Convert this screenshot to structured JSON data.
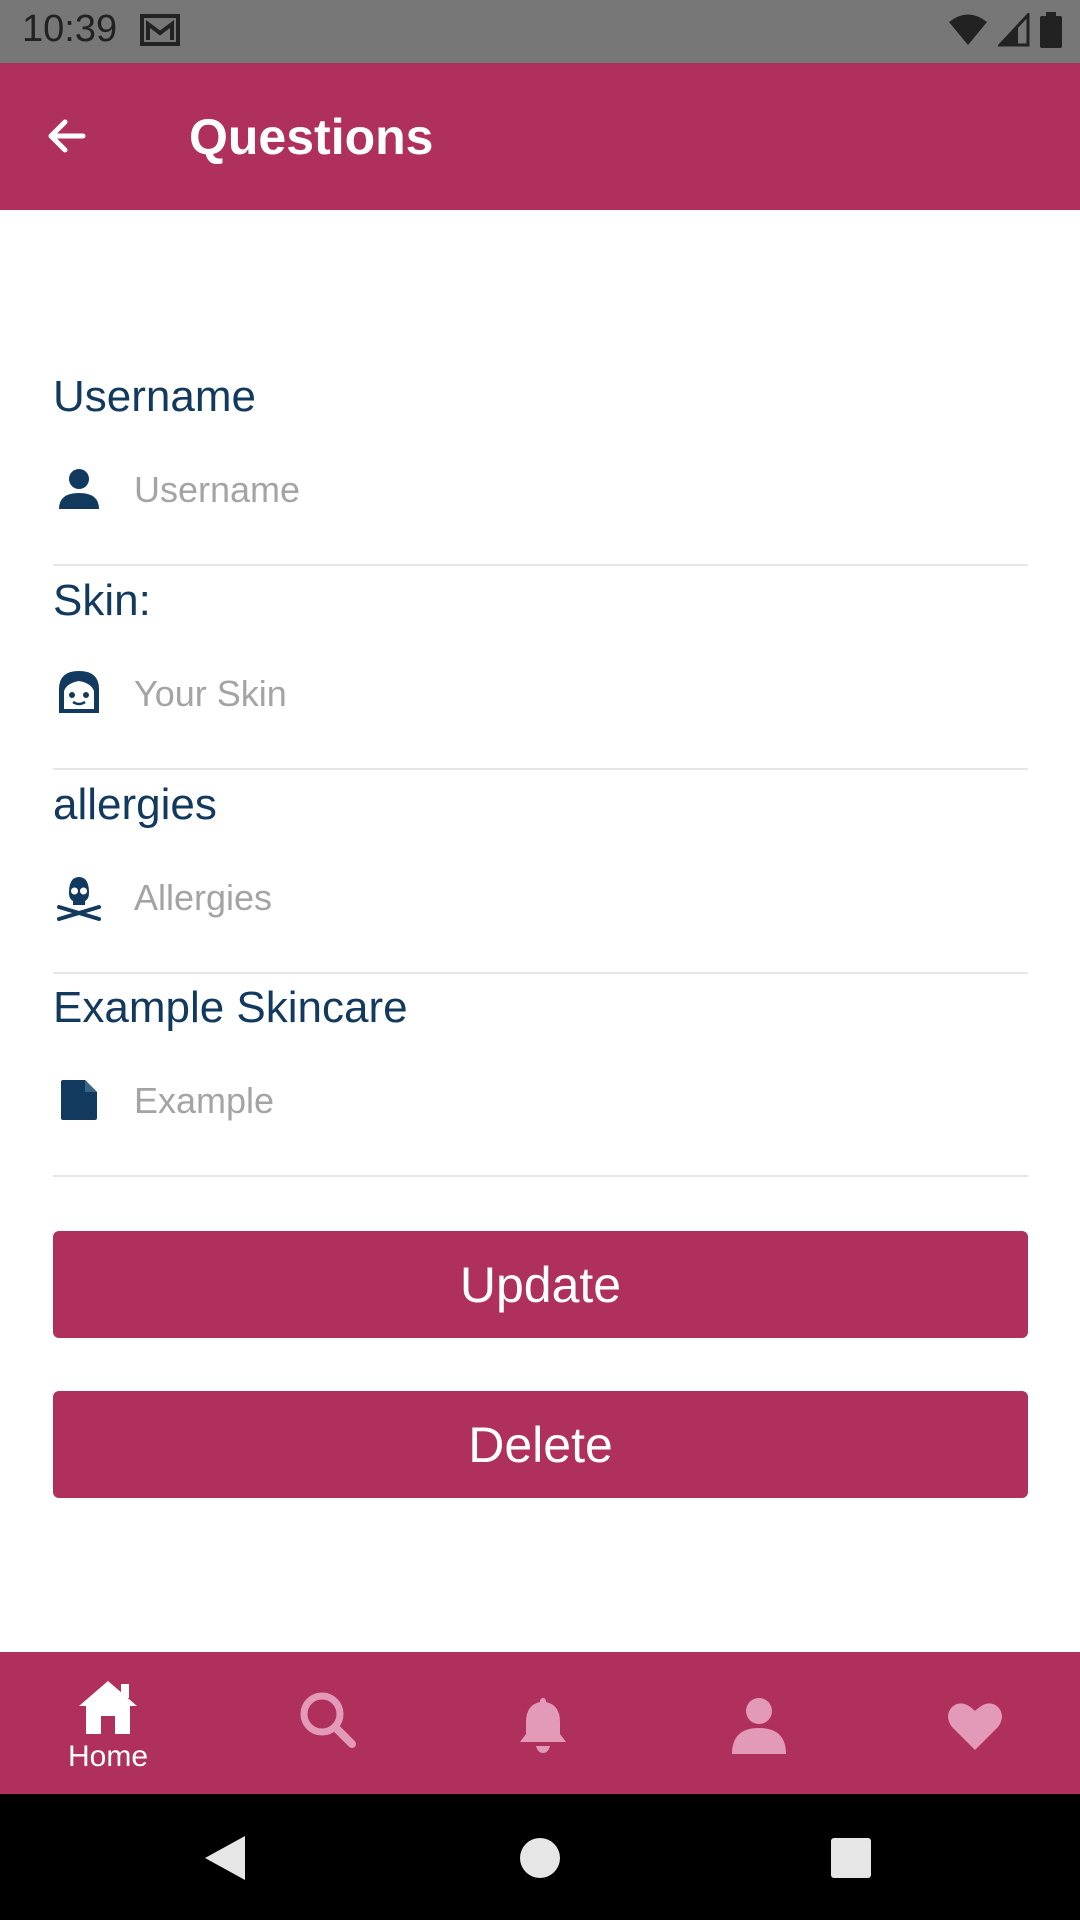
{
  "status_bar": {
    "time": "10:39",
    "icons": [
      "mail-icon",
      "wifi-icon",
      "signal-icon",
      "battery-icon"
    ]
  },
  "app_bar": {
    "title": "Questions",
    "back_icon": "arrow-left-icon"
  },
  "form": {
    "fields": [
      {
        "label": "Username",
        "placeholder": "Username",
        "value": "",
        "icon": "person-icon"
      },
      {
        "label": "Skin:",
        "placeholder": "Your Skin",
        "value": "",
        "icon": "face-icon"
      },
      {
        "label": "allergies",
        "placeholder": "Allergies",
        "value": "",
        "icon": "skull-crossbones-icon"
      },
      {
        "label": "Example Skincare",
        "placeholder": "Example",
        "value": "",
        "icon": "file-icon"
      }
    ]
  },
  "actions": {
    "update_label": "Update",
    "delete_label": "Delete"
  },
  "bottom_nav": {
    "items": [
      {
        "label": "Home",
        "icon": "home-icon",
        "active": true
      },
      {
        "label": "",
        "icon": "search-icon",
        "active": false
      },
      {
        "label": "",
        "icon": "bell-icon",
        "active": false
      },
      {
        "label": "",
        "icon": "person-icon",
        "active": false
      },
      {
        "label": "",
        "icon": "heart-icon",
        "active": false
      }
    ]
  },
  "colors": {
    "primary": "#b0305d",
    "label_text": "#123a5e",
    "placeholder": "#a4a4a4",
    "inactive_nav_icon": "#e39ab8"
  }
}
